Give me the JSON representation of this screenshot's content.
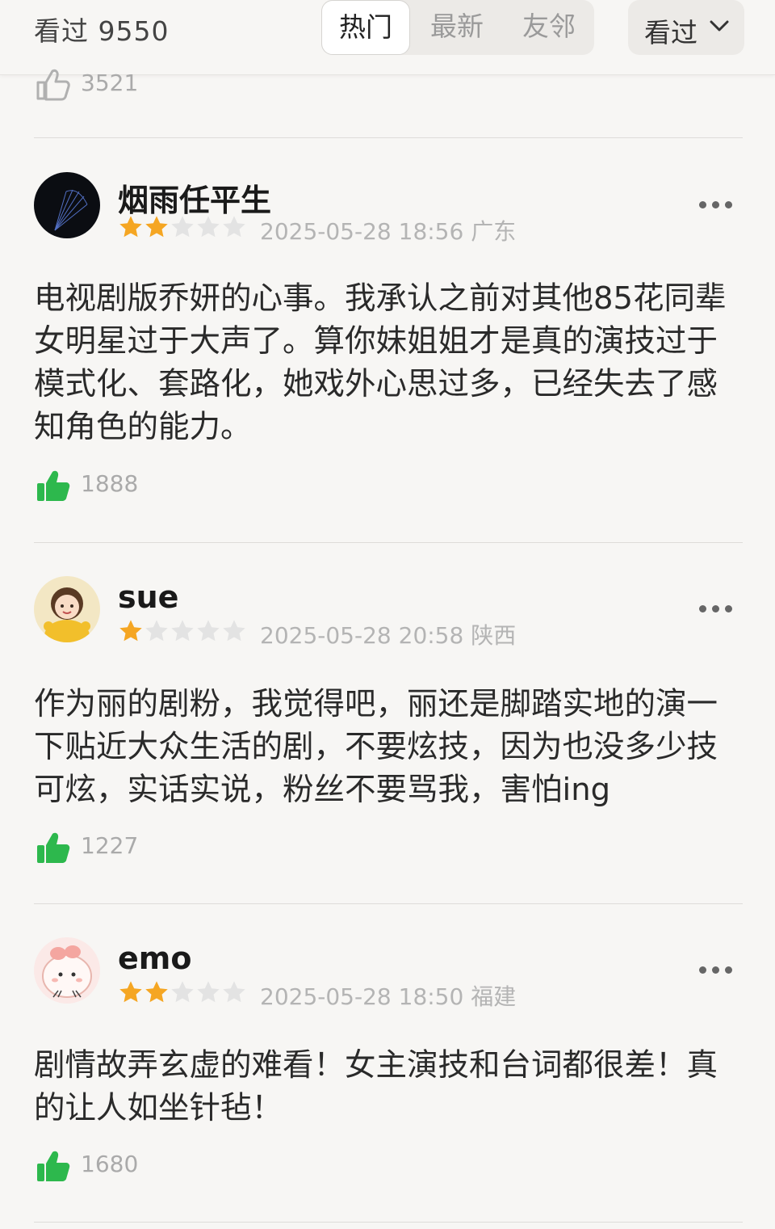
{
  "header": {
    "seen_count": "看过 9550",
    "tabs": [
      {
        "label": "热门",
        "active": true
      },
      {
        "label": "最新",
        "active": false
      },
      {
        "label": "友邻",
        "active": false
      }
    ],
    "filter_label": "看过",
    "filter_icon": "chevron-down-icon"
  },
  "previous": {
    "likes": "3521"
  },
  "colors": {
    "star_filled": "#f5a623",
    "star_empty": "#e3e3e3",
    "like_green": "#2db84d",
    "meta_gray": "#b4b4b4"
  },
  "reviews": [
    {
      "username": "烟雨任平生",
      "rating": 2,
      "max_rating": 5,
      "datetime": "2025-05-28 18:56",
      "location": "广东",
      "text": "电视剧版乔妍的心事。我承认之前对其他85花同辈女明星过于大声了。算你妹姐姐才是真的演技过于模式化、套路化，她戏外心思过多，已经失去了感知角色的能力。",
      "likes": "1888"
    },
    {
      "username": "sue",
      "rating": 1,
      "max_rating": 5,
      "datetime": "2025-05-28 20:58",
      "location": "陕西",
      "text": "作为丽的剧粉，我觉得吧，丽还是脚踏实地的演一下贴近大众生活的剧，不要炫技，因为也没多少技可炫，实话实说，粉丝不要骂我，害怕ing",
      "likes": "1227"
    },
    {
      "username": "emo",
      "rating": 2,
      "max_rating": 5,
      "datetime": "2025-05-28 18:50",
      "location": "福建",
      "text": "剧情故弄玄虚的难看！女主演技和台词都很差！真的让人如坐针毡！",
      "likes": "1680"
    }
  ]
}
